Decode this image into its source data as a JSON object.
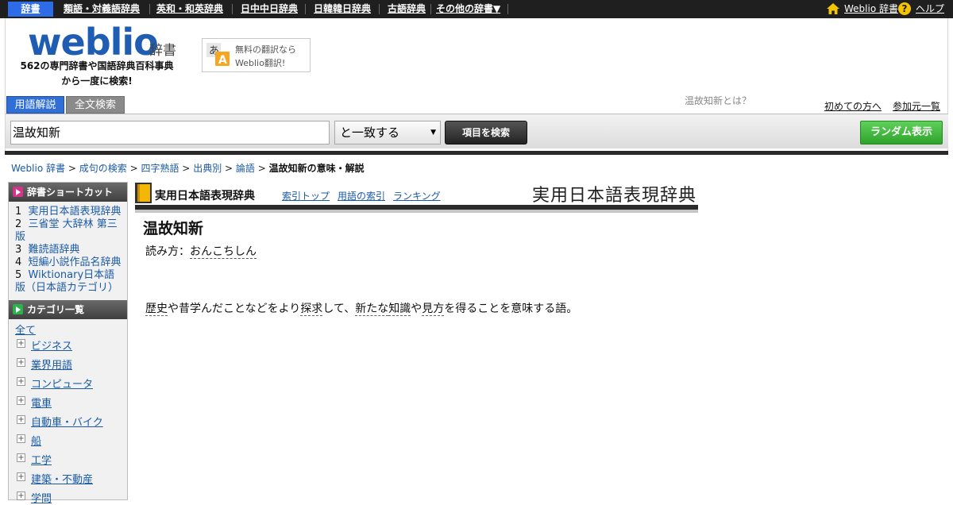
{
  "topnav": {
    "items": [
      "辞書",
      "類語・対義語辞典",
      "英和・和英辞典",
      "日中中日辞典",
      "日韓韓日辞典",
      "古語辞典",
      "その他の辞書▼"
    ],
    "weblio_link": "Weblio 辞書",
    "help_link": "ヘルプ",
    "help_icon": "?"
  },
  "header": {
    "logo": "weblio",
    "logo_sub": "辞書",
    "tagline1": "562の専門辞書や国語辞典百科事典",
    "tagline2": "から一度に検索!",
    "translate_line1": "無料の翻訳なら",
    "translate_line2": "Weblio翻訳!",
    "what_is": "温故知新とは？",
    "first_time": "初めての方へ",
    "join": "参加元一覧"
  },
  "search": {
    "tab_active": "用語解説",
    "tab_inactive": "全文検索",
    "query": "温故知新",
    "match_mode": "と一致する",
    "search_button": "項目を検索",
    "random_button": "ランダム表示"
  },
  "breadcrumb": {
    "items": [
      "Weblio 辞書",
      "成句の検索",
      "四字熟語",
      "出典別",
      "論語"
    ],
    "separator": ">",
    "current": "温故知新の意味・解説"
  },
  "sidebar": {
    "shortcut_title": "辞書ショートカット",
    "shortcuts": [
      {
        "num": "1",
        "label": "実用日本語表現辞典"
      },
      {
        "num": "2",
        "label": "三省堂 大辞林 第三版"
      },
      {
        "num": "3",
        "label": "難読語辞典"
      },
      {
        "num": "4",
        "label": "短編小説作品名辞典"
      },
      {
        "num": "5",
        "label": "Wiktionary日本語版（日本語カテゴリ）"
      }
    ],
    "category_title": "カテゴリ一覧",
    "category_all": "全て",
    "categories": [
      "ビジネス",
      "業界用語",
      "コンピュータ",
      "電車",
      "自動車・バイク",
      "船",
      "工学",
      "建築・不動産",
      "学問"
    ]
  },
  "dictionary": {
    "name": "実用日本語表現辞典",
    "links": [
      "索引トップ",
      "用語の索引",
      "ランキング"
    ],
    "logo_text": "実用日本語表現辞典"
  },
  "entry": {
    "title": "温故知新",
    "reading_label": "読み方：",
    "reading": "おんこちしん",
    "definition_parts": [
      {
        "t": "歴史",
        "u": true
      },
      {
        "t": "や昔学んだことなどをより",
        "u": false
      },
      {
        "t": "探求",
        "u": true
      },
      {
        "t": "して、",
        "u": false
      },
      {
        "t": "新たな",
        "u": true
      },
      {
        "t": "知識",
        "u": true
      },
      {
        "t": "や",
        "u": false
      },
      {
        "t": "見方",
        "u": true
      },
      {
        "t": "を得ることを意味する語。",
        "u": false
      }
    ]
  },
  "colors": {
    "topbar": "#1f1f1f",
    "logo_blue": "#1f5db3",
    "link_blue": "#1a5aa8",
    "tab_active": "#2f6fd6",
    "random_green": "#2ea32b",
    "shortcut_accent": "#d6338a",
    "category_accent": "#2bb24c"
  }
}
